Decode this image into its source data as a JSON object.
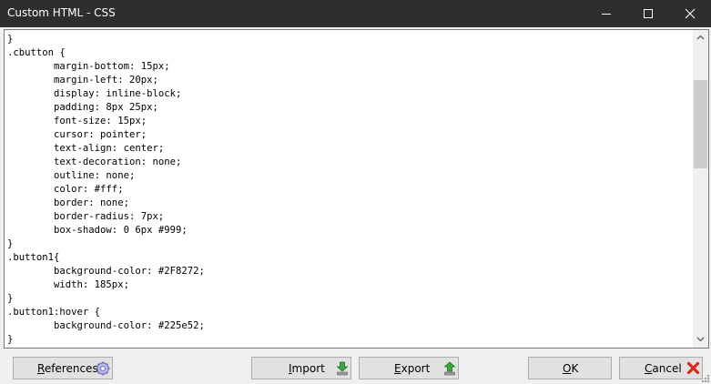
{
  "window": {
    "title": "Custom HTML - CSS"
  },
  "editor": {
    "lines": [
      "}",
      ".cbutton {",
      "\tmargin-bottom: 15px;",
      "\tmargin-left: 20px;",
      "\tdisplay: inline-block;",
      "\tpadding: 8px 25px;",
      "\tfont-size: 15px;",
      "\tcursor: pointer;",
      "\ttext-align: center;",
      "\ttext-decoration: none;",
      "\toutline: none;",
      "\tcolor: #fff;",
      "\tborder: none;",
      "\tborder-radius: 7px;",
      "\tbox-shadow: 0 6px #999;",
      "}",
      ".button1{",
      "\tbackground-color: #2F8272;",
      "\twidth: 185px;",
      "}",
      ".button1:hover {",
      "\tbackground-color: #225e52;",
      "}"
    ]
  },
  "buttons": {
    "references": {
      "mnemonic": "R",
      "rest": "eferences",
      "icon": "gear-icon"
    },
    "import": {
      "mnemonic": "I",
      "rest": "mport",
      "icon": "green-arrow-icon"
    },
    "export": {
      "mnemonic": "E",
      "rest": "xport",
      "icon": "green-arrow-icon"
    },
    "ok": {
      "mnemonic": "O",
      "rest": "K"
    },
    "cancel": {
      "mnemonic": "C",
      "rest": "ancel",
      "icon": "red-x-icon"
    }
  },
  "colors": {
    "titlebar": "#2e2e2e",
    "button_face": "#e1e1e1",
    "button_border": "#adadad",
    "scroll_thumb": "#cdcdcd",
    "icon_green": "#3aa83a",
    "icon_red": "#d9281c"
  }
}
